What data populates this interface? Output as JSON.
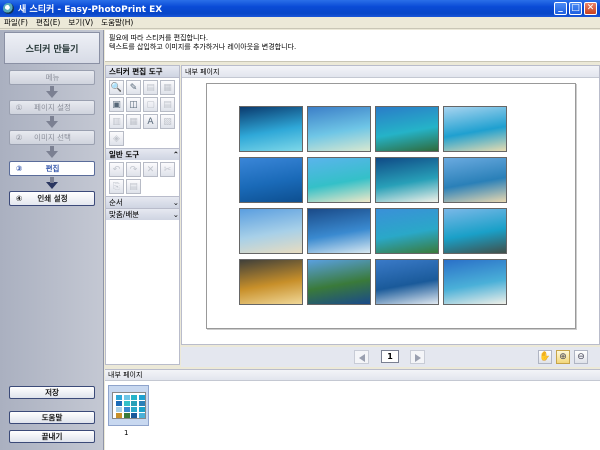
{
  "window": {
    "title": "새 스티커 - Easy-PhotoPrint EX",
    "minimize": "_",
    "maximize": "□",
    "close": "✕"
  },
  "menu": [
    "파일(F)",
    "편집(E)",
    "보기(V)",
    "도움말(H)"
  ],
  "sidebar": {
    "title": "스티커 만들기",
    "steps": [
      {
        "num": "",
        "label": "메뉴"
      },
      {
        "num": "①",
        "label": "페이지 설정"
      },
      {
        "num": "②",
        "label": "이미지 선택"
      },
      {
        "num": "③",
        "label": "편집"
      },
      {
        "num": "④",
        "label": "인쇄 설정"
      }
    ],
    "save": "저장",
    "help": "도움말",
    "exit": "끝내기"
  },
  "instructions": {
    "line1": "필요에 따라 스티커를 편집합니다.",
    "line2": "텍스트를 삽입하고 이미지를 추가하거나 레이아웃을 변경합니다."
  },
  "toolpanel": {
    "edit_tools": "스티커 편집 도구",
    "general_tools": "일반 도구",
    "order": "순서",
    "align": "맞춤/배분",
    "edit_icons": [
      "🔍",
      "✎",
      "▤",
      "▦",
      "▣",
      "◫",
      "▢",
      "▤",
      "▥",
      "▦",
      "A",
      "▧",
      "◈"
    ],
    "general_icons": [
      "↶",
      "↷",
      "✕",
      "✂",
      "⎘",
      "▤"
    ]
  },
  "main": {
    "label": "내부 페이지",
    "photos": [
      {
        "name": "photo-tropical-island",
        "colors": [
          "#0a3a6e",
          "#2fa8d8",
          "#7fd8e8"
        ]
      },
      {
        "name": "photo-pier-huts",
        "colors": [
          "#3c7fc8",
          "#6fc6e6",
          "#d8e8d0"
        ]
      },
      {
        "name": "photo-lagoon-island",
        "colors": [
          "#2a7cc8",
          "#25b3c8",
          "#2f6a3a"
        ]
      },
      {
        "name": "photo-palm-beach",
        "colors": [
          "#a8d4f0",
          "#1fa0d0",
          "#e8dcb0"
        ]
      },
      {
        "name": "photo-sea-clouds",
        "colors": [
          "#3a86d8",
          "#1a6ab8",
          "#0d4f90"
        ]
      },
      {
        "name": "photo-turquoise-bay",
        "colors": [
          "#5ab4ec",
          "#34c0c8",
          "#f0e8c8"
        ]
      },
      {
        "name": "photo-atoll-aerial",
        "colors": [
          "#0f4a86",
          "#28a0b8",
          "#f2f2e8"
        ]
      },
      {
        "name": "photo-shoreline",
        "colors": [
          "#6aaae0",
          "#2a80b8",
          "#e8d8b0"
        ]
      },
      {
        "name": "photo-calm-beach",
        "colors": [
          "#5a9ee0",
          "#a8d0e8",
          "#e8dcc0"
        ]
      },
      {
        "name": "photo-palm-silhouette",
        "colors": [
          "#1a4a88",
          "#3a8ad0",
          "#d8e8f0"
        ]
      },
      {
        "name": "photo-palm-shore",
        "colors": [
          "#3a90d8",
          "#2aa8c8",
          "#3a7a3a"
        ]
      },
      {
        "name": "photo-rocky-coast",
        "colors": [
          "#7ab8e8",
          "#1aa0c8",
          "#40504a"
        ]
      },
      {
        "name": "photo-sunset-sky",
        "colors": [
          "#40403a",
          "#c8902a",
          "#f0d898"
        ]
      },
      {
        "name": "photo-green-cliffs",
        "colors": [
          "#5aa0e0",
          "#3a7a3a",
          "#1a4a8a"
        ]
      },
      {
        "name": "photo-waves-rocks",
        "colors": [
          "#3a7ac8",
          "#1a5a9a",
          "#e0e8f0"
        ]
      },
      {
        "name": "photo-white-beach",
        "colors": [
          "#2a70c8",
          "#4ab0d8",
          "#f0f0e8"
        ]
      }
    ]
  },
  "nav": {
    "page_number": "1",
    "hand_tool": "✋",
    "zoom_in": "⊕",
    "zoom_out": "⊖"
  },
  "bottom": {
    "label": "내부 페이지",
    "thumb_label": "1"
  }
}
